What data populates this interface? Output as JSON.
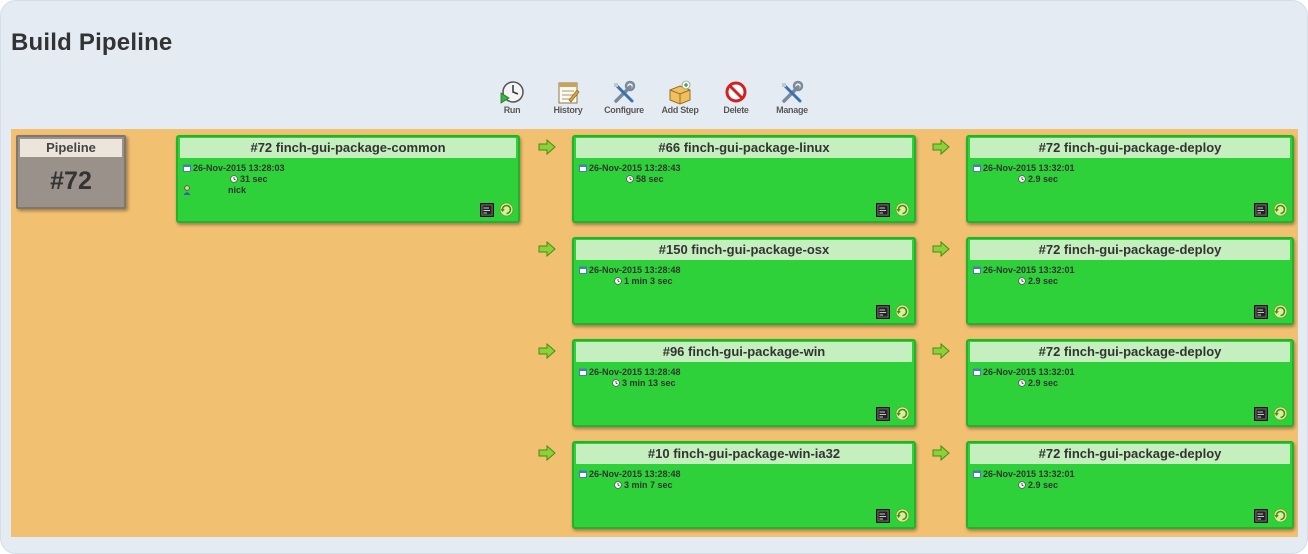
{
  "page": {
    "title": "Build Pipeline"
  },
  "toolbar": [
    {
      "label": "Run",
      "icon": "run-icon"
    },
    {
      "label": "History",
      "icon": "history-icon"
    },
    {
      "label": "Configure",
      "icon": "configure-icon"
    },
    {
      "label": "Add Step",
      "icon": "add-step-icon"
    },
    {
      "label": "Delete",
      "icon": "delete-icon"
    },
    {
      "label": "Manage",
      "icon": "manage-icon"
    }
  ],
  "pipeline": {
    "label": "Pipeline",
    "number": "#72"
  },
  "builds": [
    {
      "title": "#72 finch-gui-package-common",
      "date": "26-Nov-2015 13:28:03",
      "duration": "31 sec",
      "user": "nick"
    },
    {
      "title": "#66 finch-gui-package-linux",
      "date": "26-Nov-2015 13:28:43",
      "duration": "58 sec"
    },
    {
      "title": "#72 finch-gui-package-deploy",
      "date": "26-Nov-2015 13:32:01",
      "duration": "2.9 sec"
    },
    {
      "title": "#150 finch-gui-package-osx",
      "date": "26-Nov-2015 13:28:48",
      "duration": "1 min 3 sec"
    },
    {
      "title": "#72 finch-gui-package-deploy",
      "date": "26-Nov-2015 13:32:01",
      "duration": "2.9 sec"
    },
    {
      "title": "#96 finch-gui-package-win",
      "date": "26-Nov-2015 13:28:48",
      "duration": "3 min 13 sec"
    },
    {
      "title": "#72 finch-gui-package-deploy",
      "date": "26-Nov-2015 13:32:01",
      "duration": "2.9 sec"
    },
    {
      "title": "#10 finch-gui-package-win-ia32",
      "date": "26-Nov-2015 13:28:48",
      "duration": "3 min 7 sec"
    },
    {
      "title": "#72 finch-gui-package-deploy",
      "date": "26-Nov-2015 13:32:01",
      "duration": "2.9 sec"
    }
  ],
  "colors": {
    "background": "#e4ebf3",
    "canvas": "#f2c071",
    "success_card": "#2fd13a",
    "card_header": "#c6efbf",
    "pipeline_box": "#9a918a"
  }
}
